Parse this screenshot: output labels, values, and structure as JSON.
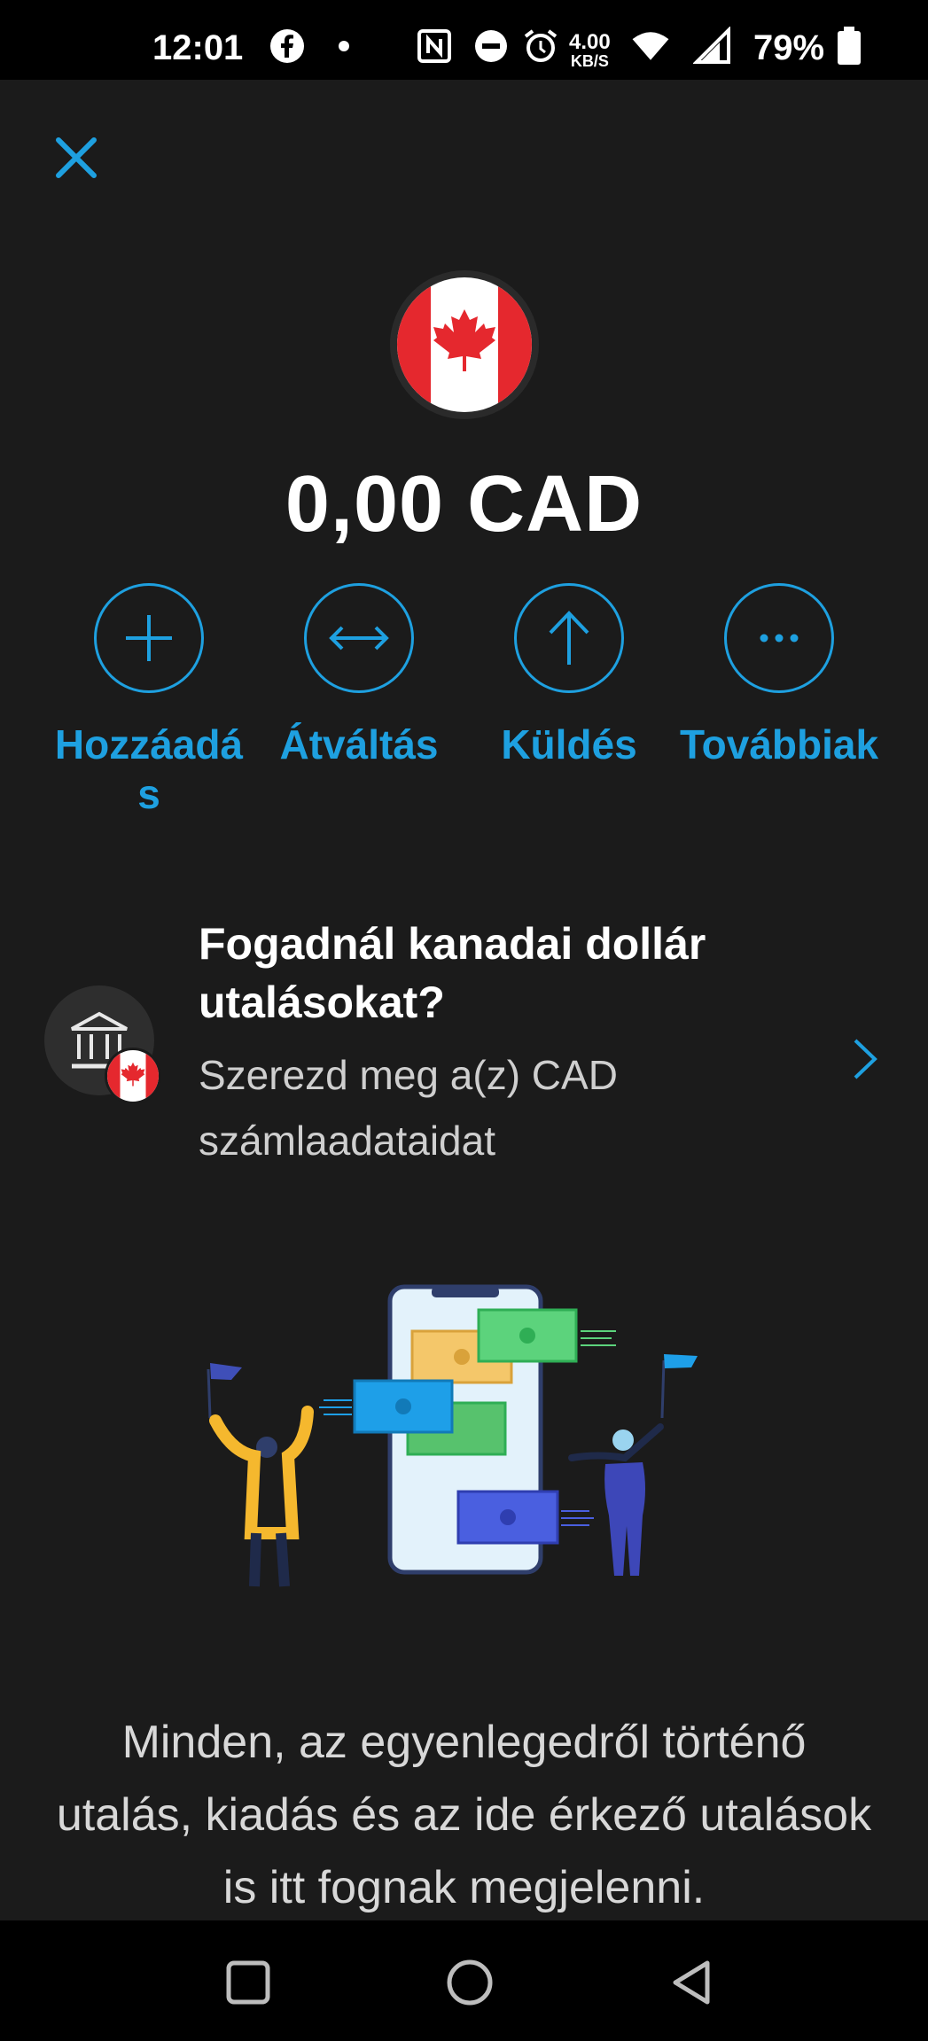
{
  "status_bar": {
    "time": "12:01",
    "speed_value": "4.00",
    "speed_unit": "KB/S",
    "battery": "79%",
    "icons": [
      "facebook-icon",
      "dot-icon",
      "nfc-icon",
      "dnd-icon",
      "alarm-icon",
      "wifi-icon",
      "signal-icon",
      "battery-icon"
    ]
  },
  "header": {
    "close_icon": "close-icon"
  },
  "account": {
    "currency_flag": "canada-flag",
    "balance": "0,00 CAD"
  },
  "actions": [
    {
      "label": "Hozzáadás",
      "icon": "plus-icon"
    },
    {
      "label": "Átváltás",
      "icon": "exchange-icon"
    },
    {
      "label": "Küldés",
      "icon": "arrow-up-icon"
    },
    {
      "label": "Továbbiak",
      "icon": "more-icon"
    }
  ],
  "banner": {
    "title": "Fogadnál kanadai dollár utalásokat?",
    "subtitle": "Szerezd meg a(z) CAD számlaadataidat"
  },
  "empty_state": {
    "text": "Minden, az egyenlegedről történő utalás, kiadás és az ide érkező utalások is itt fognak megjelenni."
  },
  "colors": {
    "accent": "#1ea0e0",
    "background": "#1b1b1b"
  }
}
